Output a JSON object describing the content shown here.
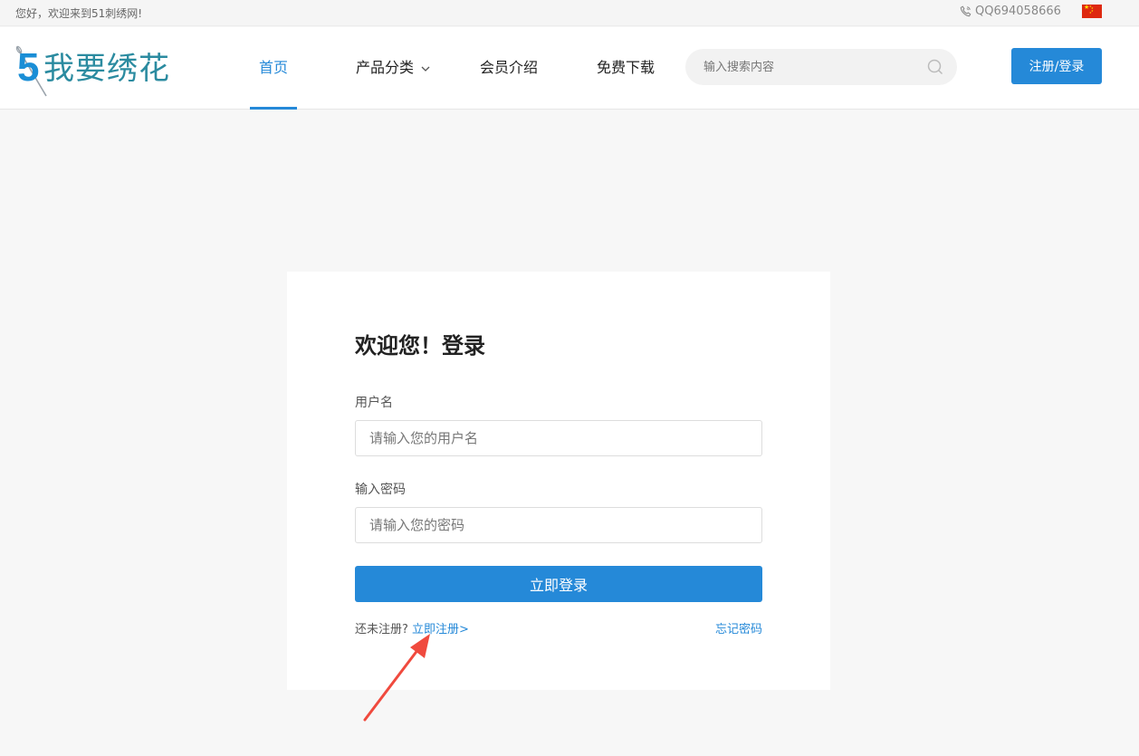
{
  "topbar": {
    "greeting": "您好，欢迎来到51刺绣网!",
    "qq": "QQ694058666"
  },
  "header": {
    "logo_digit": "5",
    "logo_text": "我要绣花",
    "nav": [
      {
        "label": "首页",
        "active": true
      },
      {
        "label": "产品分类",
        "dropdown": true
      },
      {
        "label": "会员介绍"
      },
      {
        "label": "免费下载"
      }
    ],
    "search_placeholder": "输入搜索内容",
    "register_login_label": "注册/登录"
  },
  "login": {
    "title": "欢迎您！登录",
    "username_label": "用户名",
    "username_placeholder": "请输入您的用户名",
    "password_label": "输入密码",
    "password_placeholder": "请输入您的密码",
    "submit_label": "立即登录",
    "no_account_text": "还未注册?",
    "register_link": "立即注册>",
    "forgot_link": "忘记密码"
  },
  "colors": {
    "accent": "#2589d8",
    "annotation_arrow": "#f04a3e"
  },
  "icons": [
    "phone-icon",
    "china-flag-icon",
    "search-icon",
    "chevron-down-icon",
    "annotation-arrow-icon"
  ]
}
